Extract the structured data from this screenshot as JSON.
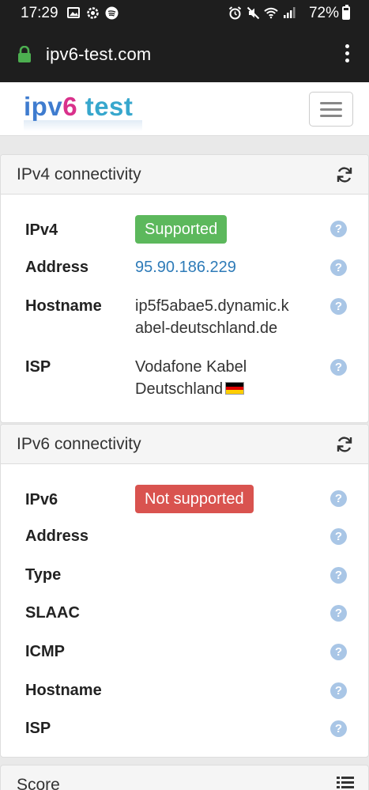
{
  "status_bar": {
    "time": "17:29",
    "battery": "72%",
    "left_icons": [
      "image-icon",
      "settings-icon",
      "spotify-icon"
    ],
    "right_icons": [
      "alarm-icon",
      "mute-icon",
      "wifi-icon",
      "signal-icon",
      "battery-icon"
    ]
  },
  "browser": {
    "url": "ipv6-test.com",
    "secure": true
  },
  "site": {
    "logo_part1": "ipv",
    "logo_part2": "6",
    "logo_part3": " test"
  },
  "ipv4": {
    "title": "IPv4 connectivity",
    "rows": [
      {
        "label": "IPv4",
        "value": "Supported"
      },
      {
        "label": "Address",
        "value": "95.90.186.229"
      },
      {
        "label": "Hostname",
        "value_line1": "ip5f5abae5.dynamic.k",
        "value_line2": "abel-deutschland.de"
      },
      {
        "label": "ISP",
        "value_line1": "Vodafone Kabel",
        "value_line2": "Deutschland"
      }
    ]
  },
  "ipv6": {
    "title": "IPv6 connectivity",
    "rows": [
      {
        "label": "IPv6",
        "value": "Not supported"
      },
      {
        "label": "Address"
      },
      {
        "label": "Type"
      },
      {
        "label": "SLAAC"
      },
      {
        "label": "ICMP"
      },
      {
        "label": "Hostname"
      },
      {
        "label": "ISP"
      }
    ]
  },
  "score": {
    "title": "Score"
  },
  "colors": {
    "supported": "#5cb85c",
    "not_supported": "#d9534f",
    "link": "#2e7bb8",
    "help_icon": "#a9c6e6"
  }
}
